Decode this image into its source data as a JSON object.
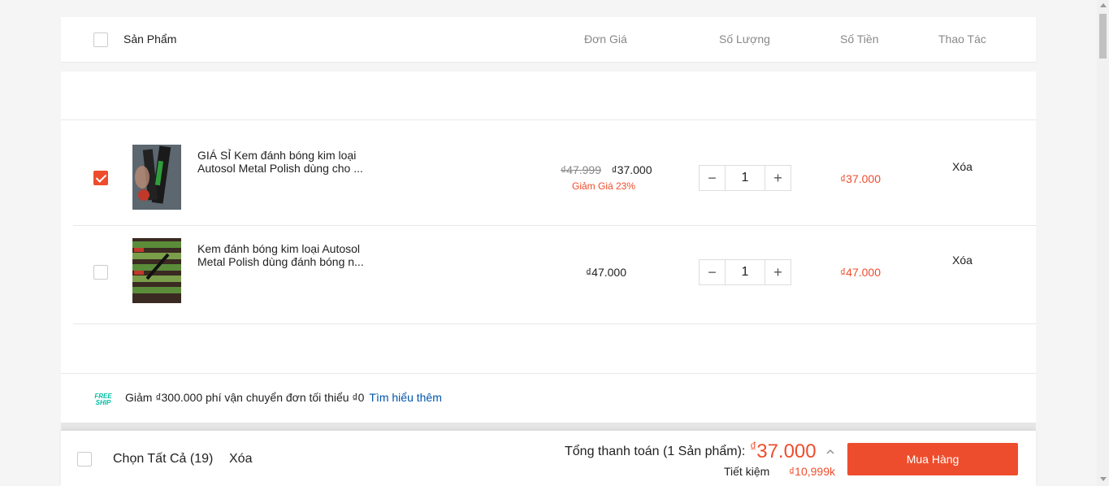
{
  "header": {
    "product": "Sản Phẩm",
    "unit_price": "Đơn Giá",
    "quantity": "Số Lượng",
    "amount": "Số Tiền",
    "action": "Thao Tác"
  },
  "items": [
    {
      "name": "GIÁ SỈ Kem đánh bóng kim loại Autosol Metal Polish dùng cho ...",
      "old_price": "₫47.999",
      "price": "₫37.000",
      "discount": "Giảm Giá 23%",
      "quantity": "1",
      "total": "₫37.000",
      "delete": "Xóa",
      "checked": true
    },
    {
      "name": "Kem đánh bóng kim loại Autosol Metal Polish dùng đánh bóng n...",
      "price": "₫47.000",
      "quantity": "1",
      "total": "₫47.000",
      "delete": "Xóa",
      "checked": false
    }
  ],
  "shipping": {
    "badge_top": "FREE",
    "badge_bottom": "SHIP",
    "text": "Giảm ₫300.000 phí vận chuyển đơn tối thiểu ₫0",
    "link": "Tìm hiểu thêm"
  },
  "footer": {
    "select_all": "Chọn Tất Cả (19)",
    "delete": "Xóa",
    "total_label": "Tổng thanh toán (1 Sản phẩm):",
    "currency": "₫",
    "total_value": "37.000",
    "save_label": "Tiết kiệm",
    "save_value": "₫10,999k",
    "buy": "Mua Hàng"
  },
  "colors": {
    "accent": "#ee4d2d",
    "link": "#0055aa",
    "freeship": "#00bfa5"
  }
}
